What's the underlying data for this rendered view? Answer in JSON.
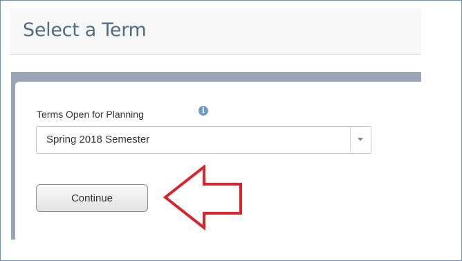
{
  "page": {
    "title": "Select a Term"
  },
  "term_field": {
    "label": "Terms Open for Planning",
    "info_icon": "info-icon",
    "selected_value": "Spring 2018 Semester",
    "dropdown_icon": "chevron-down-icon"
  },
  "actions": {
    "continue_label": "Continue"
  },
  "annotation": {
    "icon": "left-arrow-outline-icon",
    "color": "#d9252a"
  },
  "colors": {
    "title": "#4f6d82",
    "panel_border": "#9aa6b6",
    "info": "#6c9bd2"
  }
}
